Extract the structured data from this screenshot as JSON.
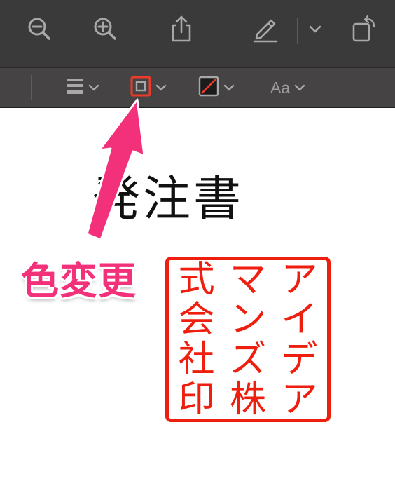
{
  "toolbar_top": {
    "buttons": [
      "zoom-out",
      "zoom-in",
      "share",
      "markup",
      "more",
      "rotate"
    ]
  },
  "toolbar_sub": {
    "font_button_label": "Aa"
  },
  "document": {
    "title": "発注書"
  },
  "annotation": {
    "label": "色変更",
    "color": "#f3307a"
  },
  "stamp": {
    "color": "#ef1f10",
    "rows": [
      [
        "式",
        "マ",
        "ア"
      ],
      [
        "会",
        "ン",
        "イ"
      ],
      [
        "社",
        "ズ",
        "デ"
      ],
      [
        "印",
        "株",
        "ア"
      ]
    ]
  },
  "colors": {
    "toolbar_bg": "#3b3a3a",
    "toolbar_sub_bg": "#454343",
    "icon": "#a8a8a8",
    "border_color_swatch": "#ef3a2a"
  }
}
